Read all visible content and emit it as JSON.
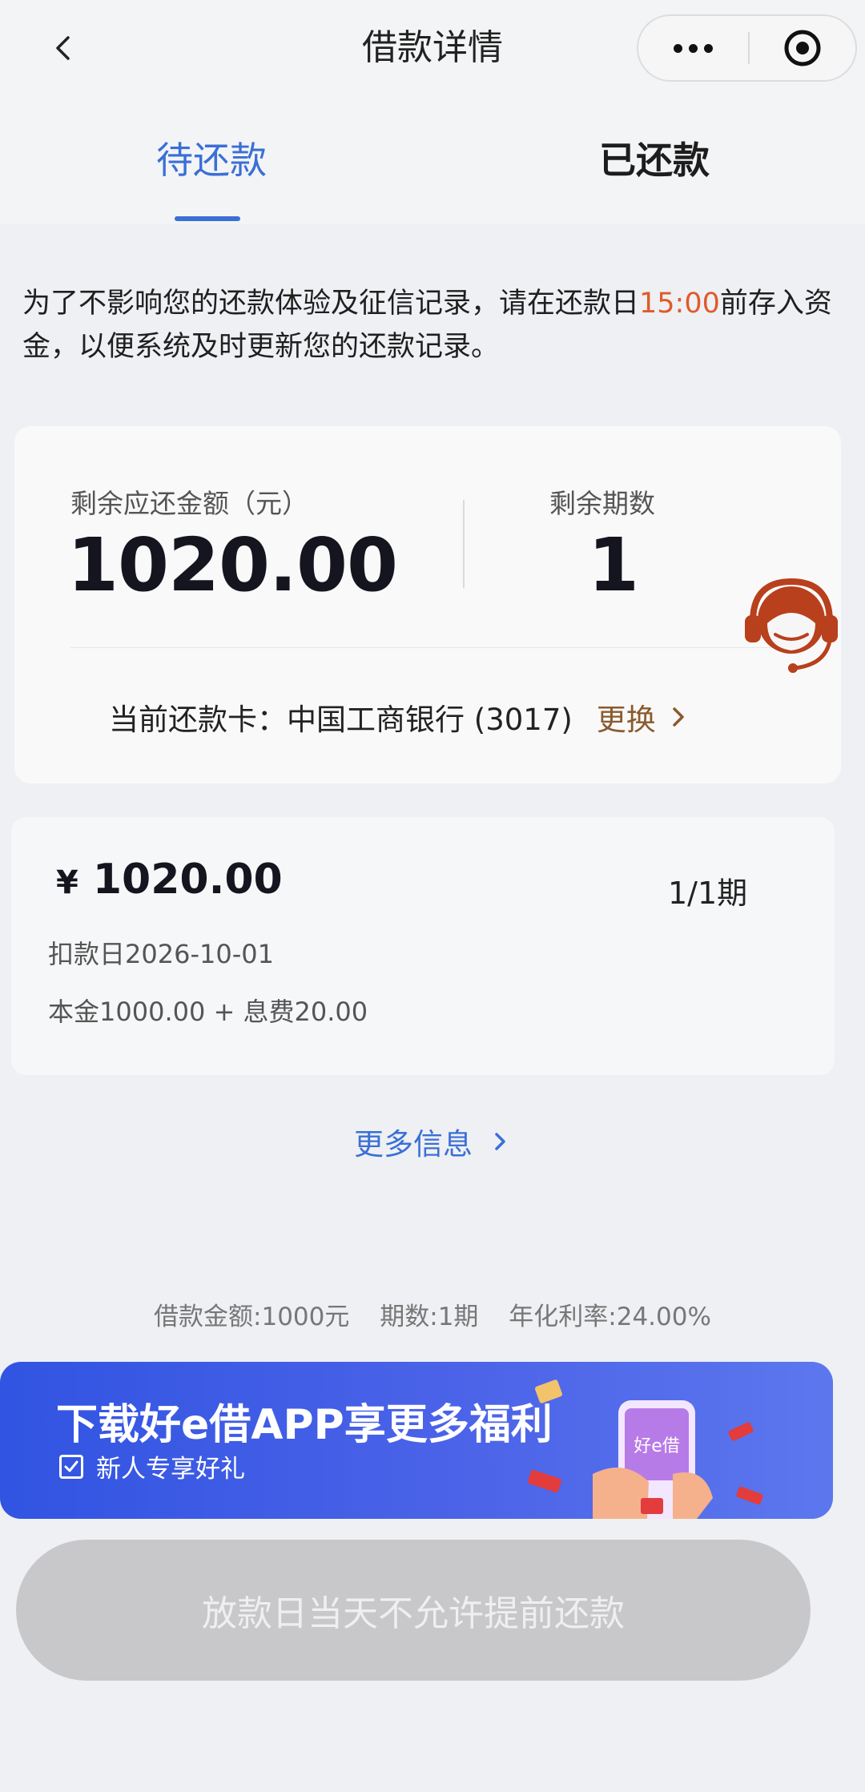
{
  "header": {
    "title": "借款详情",
    "back_icon": "back-arrow-icon",
    "more_icon": "more-dots-icon",
    "close_icon": "target-icon"
  },
  "tabs": [
    {
      "label": "待还款",
      "active": true
    },
    {
      "label": "已还款",
      "active": false
    }
  ],
  "notice": {
    "before": "为了不影响您的还款体验及征信记录，请在还款日",
    "time": "15:00",
    "after": "前存入资金，以便系统及时更新您的还款记录。",
    "highlight_color": "#e05a2b"
  },
  "summary": {
    "remaining_amount_label": "剩余应还金额（元）",
    "remaining_amount_value": "1020.00",
    "remaining_periods_label": "剩余期数",
    "remaining_periods_value": "1",
    "card_label": "当前还款卡：",
    "card_value": "中国工商银行 (3017)",
    "change_label": "更换"
  },
  "installment": {
    "currency": "¥",
    "amount": "1020.00",
    "period": "1/1期",
    "due_date": "扣款日2026-10-01",
    "breakdown": "本金1000.00 + 息费20.00"
  },
  "more_info": {
    "label": "更多信息"
  },
  "loan_summary": {
    "amount": "借款金额:1000元",
    "periods": "期数:1期",
    "rate": "年化利率:24.00%"
  },
  "banner": {
    "title": "下载好e借APP享更多福利",
    "subtitle": "新人专享好礼",
    "phone_text": "好e借"
  },
  "bottom_button": {
    "label": "放款日当天不允许提前还款",
    "disabled": true
  },
  "colors": {
    "accent": "#3b6fd6",
    "warning": "#e05a2b",
    "change_link": "#8a5a2e",
    "banner": "#3154e2"
  }
}
